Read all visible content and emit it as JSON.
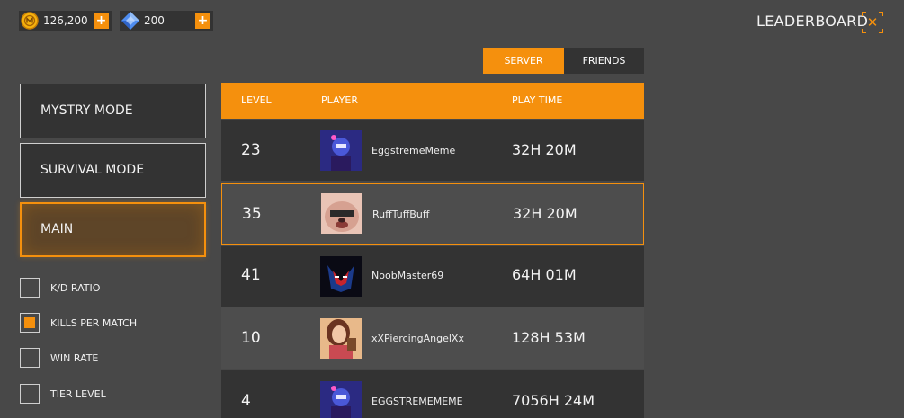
{
  "currency": {
    "coins": {
      "amount": "126,200",
      "icon": "gold-coin-icon",
      "color": "#f5b20d"
    },
    "gems": {
      "amount": "200",
      "icon": "blue-gem-icon",
      "color": "#4f8df0"
    },
    "plus_label": "+"
  },
  "header": {
    "title": "LEADERBOARD",
    "close_label": "✕"
  },
  "scope_tabs": {
    "server": "SERVER",
    "friends": "FRIENDS",
    "active": "SERVER"
  },
  "modes": [
    {
      "label": "MYSTRY MODE",
      "selected": false
    },
    {
      "label": "SURVIVAL MODE",
      "selected": false
    },
    {
      "label": "MAIN",
      "selected": true
    }
  ],
  "filters": [
    {
      "label": "K/D RATIO",
      "checked": false
    },
    {
      "label": "KILLS PER MATCH",
      "checked": true
    },
    {
      "label": "WIN RATE",
      "checked": false
    },
    {
      "label": "TIER LEVEL",
      "checked": false
    }
  ],
  "table": {
    "columns": {
      "level": "LEVEL",
      "player": "PLAYER",
      "play_time": "PLAY TIME"
    },
    "rows": [
      {
        "level": "23",
        "player": "EggstremeMeme",
        "play_time": "32H 20M",
        "avatar": "blue-robot-avatar"
      },
      {
        "level": "35",
        "player": "RuffTuffBuff",
        "play_time": "32H 20M",
        "avatar": "pink-dog-avatar",
        "selected": true
      },
      {
        "level": "41",
        "player": "NoobMaster69",
        "play_time": "64H 01M",
        "avatar": "red-blue-mask-avatar"
      },
      {
        "level": "10",
        "player": "xXPiercingAngelXx",
        "play_time": "128H 53M",
        "avatar": "woman-portrait-avatar"
      },
      {
        "level": "4",
        "player": "EGGSTREMEMEME",
        "play_time": "7056H 24M",
        "avatar": "blue-robot-avatar"
      }
    ]
  },
  "colors": {
    "accent": "#f5900d",
    "background": "#484848",
    "panel": "#333333",
    "row_alt": "#4d4d4d"
  }
}
